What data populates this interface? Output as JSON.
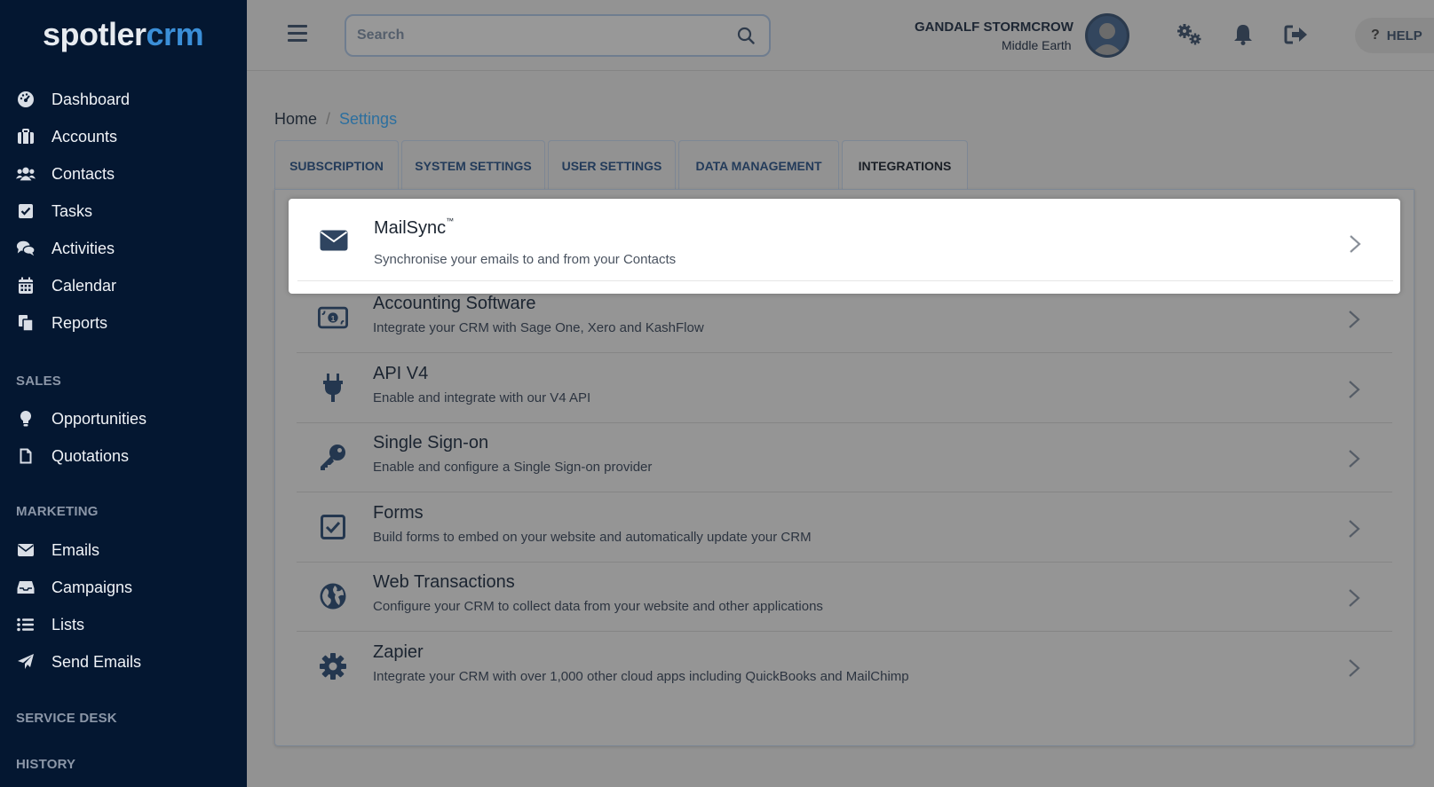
{
  "logo": {
    "part1": "spotler",
    "part2": "crm"
  },
  "sidebar": {
    "main": [
      {
        "label": "Dashboard",
        "icon": "dashboard-icon"
      },
      {
        "label": "Accounts",
        "icon": "briefcase-icon"
      },
      {
        "label": "Contacts",
        "icon": "users-icon"
      },
      {
        "label": "Tasks",
        "icon": "checkbox-icon"
      },
      {
        "label": "Activities",
        "icon": "comments-icon"
      },
      {
        "label": "Calendar",
        "icon": "calendar-icon"
      },
      {
        "label": "Reports",
        "icon": "copy-icon"
      }
    ],
    "sales_header": "SALES",
    "sales": [
      {
        "label": "Opportunities",
        "icon": "lightbulb-icon"
      },
      {
        "label": "Quotations",
        "icon": "file-icon"
      }
    ],
    "marketing_header": "MARKETING",
    "marketing": [
      {
        "label": "Emails",
        "icon": "envelope-icon"
      },
      {
        "label": "Campaigns",
        "icon": "inbox-icon"
      },
      {
        "label": "Lists",
        "icon": "list-icon"
      },
      {
        "label": "Send Emails",
        "icon": "paper-plane-icon"
      }
    ],
    "service_header": "SERVICE DESK",
    "history_header": "HISTORY"
  },
  "header": {
    "search_placeholder": "Search",
    "user_name": "GANDALF STORMCROW",
    "user_location": "Middle Earth",
    "help_label": "HELP"
  },
  "breadcrumb": {
    "home": "Home",
    "separator": "/",
    "current": "Settings"
  },
  "tabs": [
    {
      "label": "SUBSCRIPTION"
    },
    {
      "label": "SYSTEM SETTINGS"
    },
    {
      "label": "USER SETTINGS"
    },
    {
      "label": "DATA MANAGEMENT"
    },
    {
      "label": "INTEGRATIONS",
      "active": true
    }
  ],
  "integrations": [
    {
      "title": "MailSync",
      "tm": "™",
      "desc": "Synchronise your emails to and from your Contacts",
      "icon": "envelope-icon"
    },
    {
      "title": "Accounting Software",
      "desc": "Integrate your CRM with Sage One, Xero and KashFlow",
      "icon": "money-bill-icon"
    },
    {
      "title": "API V4",
      "desc": "Enable and integrate with our V4 API",
      "icon": "plug-icon"
    },
    {
      "title": "Single Sign-on",
      "desc": "Enable and configure a Single Sign-on provider",
      "icon": "key-icon"
    },
    {
      "title": "Forms",
      "desc": "Build forms to embed on your website and automatically update your CRM",
      "icon": "checkbox-outline-icon"
    },
    {
      "title": "Web Transactions",
      "desc": "Configure your CRM to collect data from your website and other applications",
      "icon": "globe-icon"
    },
    {
      "title": "Zapier",
      "desc": "Integrate your CRM with over 1,000 other cloud apps including QuickBooks and MailChimp",
      "icon": "gear-icon"
    }
  ],
  "colors": {
    "sidebar_bg": "#041731",
    "accent": "#3b8fd8",
    "icon_dark": "#2f4460"
  }
}
